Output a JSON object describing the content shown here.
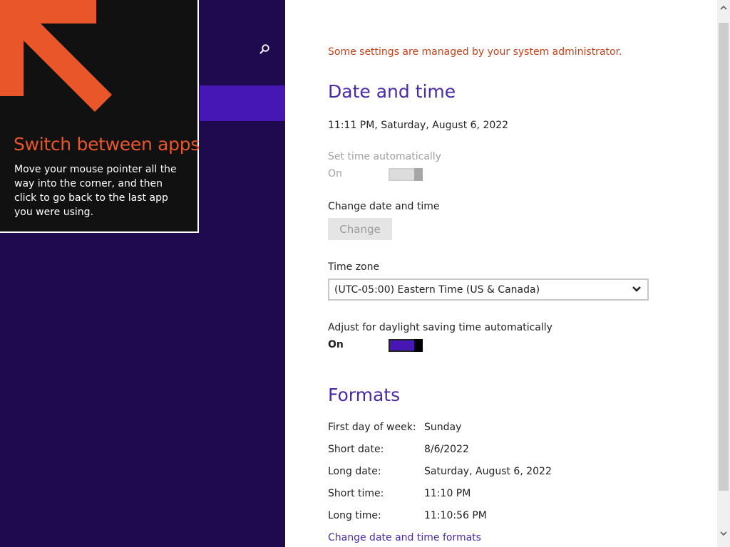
{
  "left": {
    "search_icon": "search-icon",
    "background_color": "#1f0a50",
    "highlight_color": "#4617b4"
  },
  "tip": {
    "title": "Switch between apps",
    "body": "Move your mouse pointer all the way into the corner, and then click to go back to the last app you were using.",
    "arrow_icon": "arrow-up-left-icon",
    "accent_color": "#e8562a"
  },
  "settings": {
    "admin_notice": "Some settings are managed by your system administrator.",
    "date_time": {
      "heading": "Date and time",
      "current": "11:11 PM, Saturday, August 6, 2022",
      "set_auto_label": "Set time automatically",
      "set_auto_state": "On",
      "change_label": "Change date and time",
      "change_button": "Change",
      "timezone_label": "Time zone",
      "timezone_value": "(UTC-05:00) Eastern Time (US & Canada)",
      "dst_label": "Adjust for daylight saving time automatically",
      "dst_state": "On"
    },
    "formats": {
      "heading": "Formats",
      "rows": [
        {
          "label": "First day of week:",
          "value": "Sunday"
        },
        {
          "label": "Short date:",
          "value": "8/6/2022"
        },
        {
          "label": "Long date:",
          "value": "Saturday, August 6, 2022"
        },
        {
          "label": "Short time:",
          "value": "11:10 PM"
        },
        {
          "label": "Long time:",
          "value": "11:10:56 PM"
        }
      ],
      "change_link": "Change date and time formats"
    }
  },
  "colors": {
    "accent_text": "#4a2aa8",
    "warning_text": "#c8401a",
    "toggle_on": "#4617b4"
  }
}
